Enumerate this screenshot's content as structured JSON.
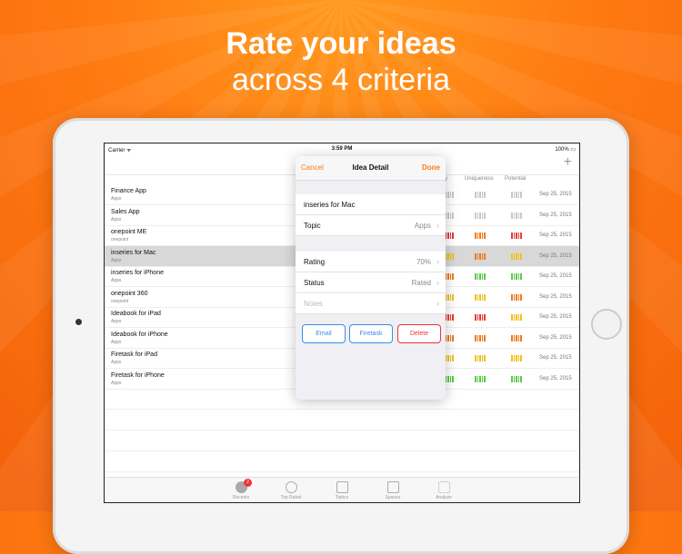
{
  "headline": {
    "line1": "Rate your ideas",
    "line2": "across 4 criteria"
  },
  "status_bar": {
    "carrier": "Carrier ᯤ",
    "time": "3:59 PM",
    "battery": "100% ▭"
  },
  "navbar": {
    "add_icon": "plus-icon"
  },
  "columns": {
    "feasibility_partial": "city",
    "uniqueness": "Uniqueness",
    "potential": "Potential"
  },
  "ideas": [
    {
      "title": "Finance App",
      "topic": "Apps",
      "date": "Sep 25, 2015",
      "uniq": "#c8c8c8",
      "pot": "#c8c8c8",
      "feas": "#c8c8c8"
    },
    {
      "title": "Sales App",
      "topic": "Apps",
      "date": "Sep 25, 2015",
      "uniq": "#c8c8c8",
      "pot": "#c8c8c8",
      "feas": "#c8c8c8"
    },
    {
      "title": "onepoint ME",
      "topic": "onepoint",
      "date": "Sep 25, 2015",
      "uniq": "#f07a1a",
      "pot": "#e83a3a",
      "feas": "#e83a3a"
    },
    {
      "title": "inseries for Mac",
      "topic": "Apps",
      "date": "Sep 25, 2015",
      "uniq": "#f07a1a",
      "pot": "#f2c01a",
      "feas": "#f2c01a"
    },
    {
      "title": "inseries for iPhone",
      "topic": "Apps",
      "date": "Sep 25, 2015",
      "uniq": "#5cc84a",
      "pot": "#5cc84a",
      "feas": "#f07a1a"
    },
    {
      "title": "onepoint 360",
      "topic": "onepoint",
      "date": "Sep 25, 2015",
      "uniq": "#f2c01a",
      "pot": "#f07a1a",
      "feas": "#f2c01a"
    },
    {
      "title": "Ideabook for iPad",
      "topic": "Apps",
      "date": "Sep 25, 2015",
      "uniq": "#e83a3a",
      "pot": "#f2c01a",
      "feas": "#e83a3a"
    },
    {
      "title": "Ideabook for iPhone",
      "topic": "Apps",
      "date": "Sep 25, 2015",
      "uniq": "#f07a1a",
      "pot": "#f07a1a",
      "feas": "#f07a1a"
    },
    {
      "title": "Firetask for iPad",
      "topic": "Apps",
      "date": "Sep 25, 2015",
      "uniq": "#f2c01a",
      "pot": "#f2c01a",
      "feas": "#f2c01a"
    },
    {
      "title": "Firetask for iPhone",
      "topic": "Apps",
      "date": "Sep 25, 2015",
      "uniq": "#5cc84a",
      "pot": "#5cc84a",
      "feas": "#5cc84a"
    }
  ],
  "popover": {
    "cancel": "Cancel",
    "title": "Idea Detail",
    "done": "Done",
    "name": "inseries for Mac",
    "topic_label": "Topic",
    "topic_value": "Apps",
    "rating_label": "Rating",
    "rating_value": "70%",
    "status_label": "Status",
    "status_value": "Rated",
    "notes_placeholder": "Notes",
    "email": "Email",
    "firetask": "Firetask",
    "delete": "Delete"
  },
  "tabs": [
    {
      "label": "Recents",
      "icon": "clock-icon",
      "badge": "2"
    },
    {
      "label": "Top Rated",
      "icon": "lightbulb-icon"
    },
    {
      "label": "Topics",
      "icon": "folder-icon"
    },
    {
      "label": "Spaces",
      "icon": "grid-icon"
    },
    {
      "label": "Analyze",
      "icon": "dots-icon"
    }
  ]
}
